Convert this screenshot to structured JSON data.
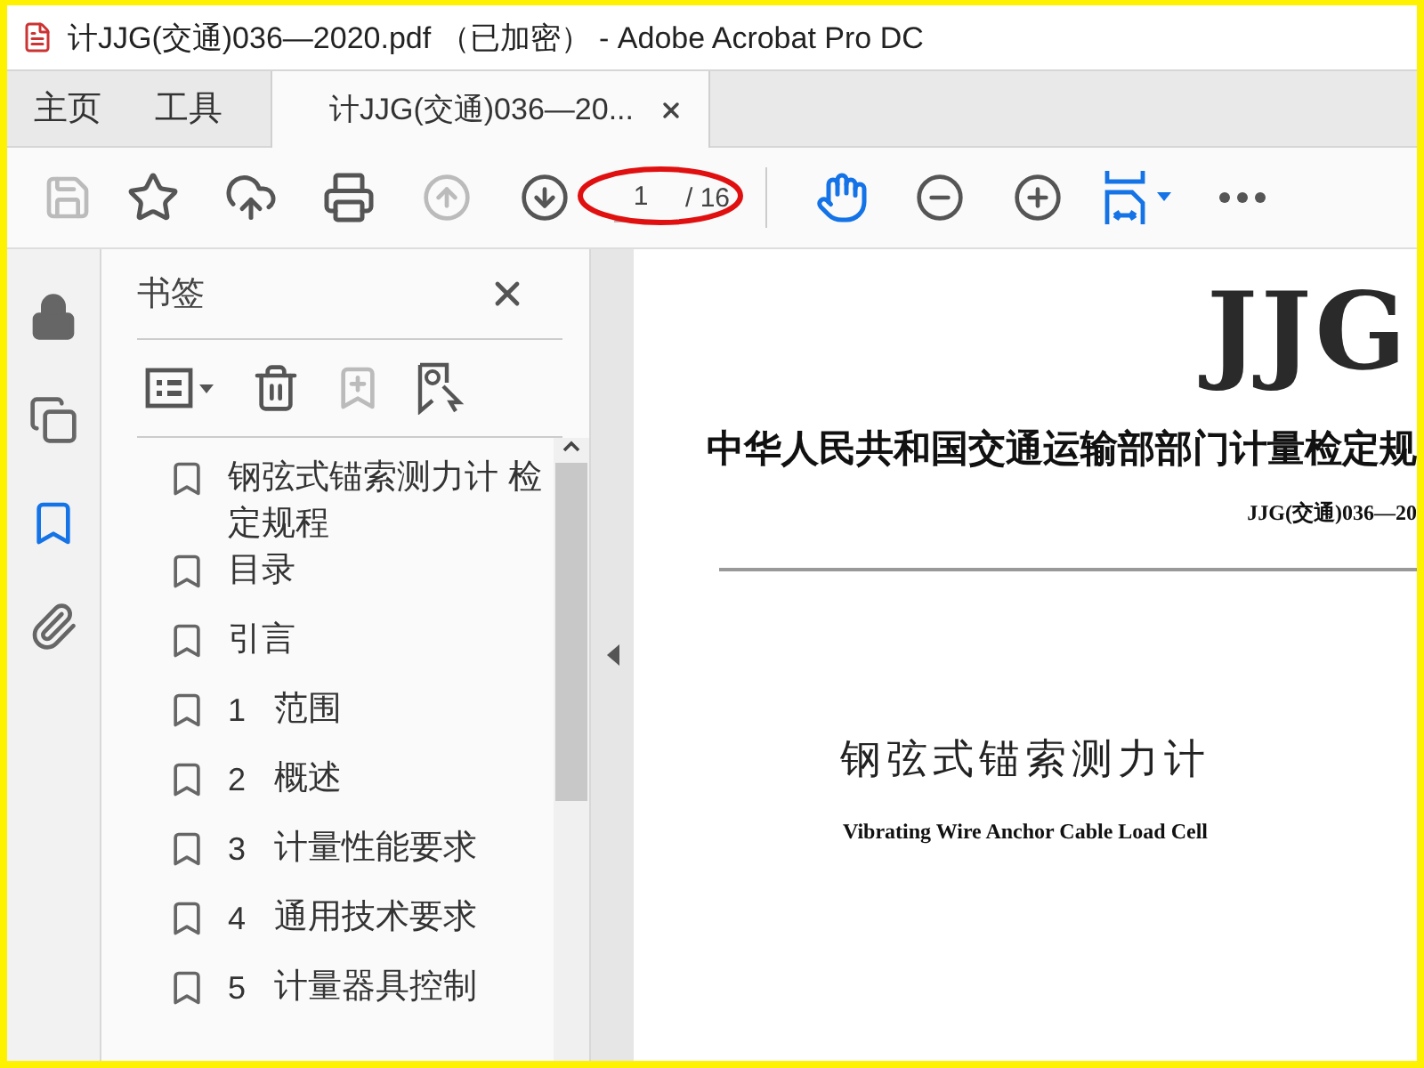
{
  "window": {
    "title": "计JJG(交通)036—2020.pdf （已加密） - Adobe Acrobat Pro DC"
  },
  "tabs": [
    {
      "label": "主页",
      "kind": "nav",
      "selected": false
    },
    {
      "label": "工具",
      "kind": "nav",
      "selected": false
    },
    {
      "label": "计JJG(交通)036—20...",
      "kind": "document",
      "selected": true
    }
  ],
  "toolbar": {
    "page_field": {
      "value": "1"
    },
    "page_total": "/ 16"
  },
  "sidebar": {
    "items": [
      {
        "kind": "lock",
        "selected": false
      },
      {
        "kind": "pages",
        "selected": false
      },
      {
        "kind": "bookmarks",
        "selected": true
      },
      {
        "kind": "attachments",
        "selected": false
      }
    ]
  },
  "bookmarks": {
    "title": "书签",
    "items": [
      {
        "title": "钢弦式锚索测力计 检定规程"
      },
      {
        "title": "目录"
      },
      {
        "title": "引言"
      },
      {
        "number": "1",
        "title": "范围"
      },
      {
        "number": "2",
        "title": "概述"
      },
      {
        "number": "3",
        "title": "计量性能要求"
      },
      {
        "number": "4",
        "title": "通用技术要求"
      },
      {
        "number": "5",
        "title": "计量器具控制"
      }
    ]
  },
  "document": {
    "logo": "JJG",
    "heading": "中华人民共和国交通运输部部门计量检定规",
    "code": "JJG(交通)036—20",
    "title": "钢弦式锚索测力计",
    "subtitle": "Vibrating Wire Anchor Cable Load Cell"
  }
}
